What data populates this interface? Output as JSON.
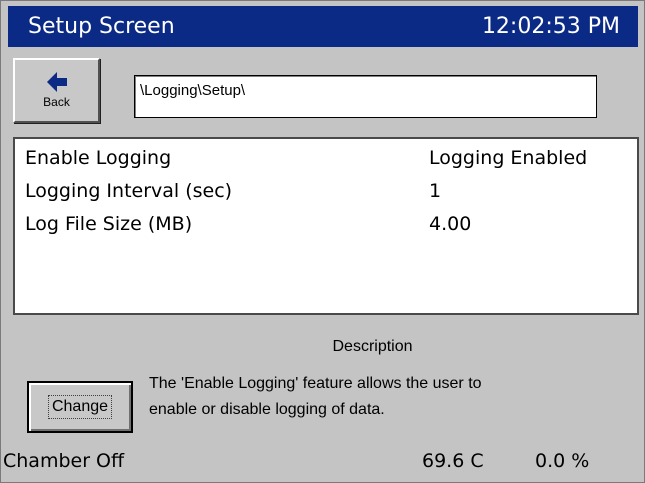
{
  "header": {
    "title": "Setup Screen",
    "time": "12:02:53 PM"
  },
  "nav": {
    "back_label": "Back",
    "back_icon": "arrow-left-icon",
    "path": "\\Logging\\Setup\\"
  },
  "settings": [
    {
      "name": "Enable Logging",
      "value": "Logging Enabled"
    },
    {
      "name": "Logging Interval (sec)",
      "value": "1"
    },
    {
      "name": "Log File Size (MB)",
      "value": "4.00"
    }
  ],
  "description": {
    "title": "Description",
    "line1": "The 'Enable Logging' feature allows the user to",
    "line2": "enable or disable logging of data."
  },
  "actions": {
    "change_label": "Change"
  },
  "status": {
    "chamber": "Chamber Off",
    "temperature": "69.6 C",
    "percent": "0.0 %"
  },
  "colors": {
    "titlebar": "#0a2a85",
    "background": "#c4c4c4"
  }
}
